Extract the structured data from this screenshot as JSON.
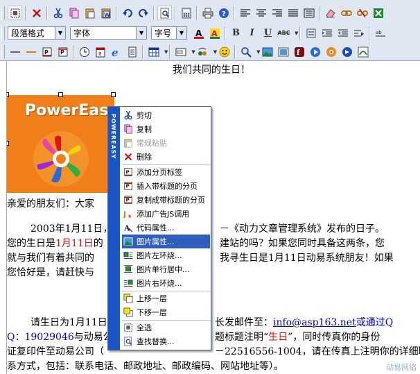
{
  "toolbar": {
    "row1": [
      "source-view-icon",
      "delete-icon",
      "cut-icon",
      "copy-icon",
      "paste-icon",
      "paste-word-icon",
      "undo-icon",
      "redo-icon",
      "preview-icon",
      "calculator-icon",
      "print-icon",
      "help-icon",
      "align-left-icon",
      "align-center-icon",
      "align-right-icon",
      "justify-icon",
      "full-width-icon",
      "eraser-icon",
      "link-icon",
      "unlink-icon",
      "excel-icon"
    ],
    "paragraph_format": "段落格式",
    "font_family": "字体",
    "font_size": "字号",
    "format_buttons": {
      "bold": "B",
      "italic": "I",
      "underline": "U",
      "abc": "ABC"
    },
    "accent_color": "#c00000"
  },
  "document": {
    "title": "我们共同的生日！",
    "greeting": "亲爱的朋友们：大家",
    "p1_line1_a": "2003年1月11日，",
    "p1_line1_b": "－《动力文章管理系统》发布的日子。",
    "p1_line2_a": "您的生日是",
    "p1_line2_red": "1月11日",
    "p1_line2_b": "的",
    "p1_line2_c": "建站的吗？如果您同时具备这两条，您",
    "p1_line3_a": "就与我们有着共同的",
    "p1_line3_b": "我寻生日是1月11日动易系统朋友！如果",
    "p1_line4_a": "您恰好是，请赶快与",
    "p2_line1_a": "请生日为1月11日",
    "p2_line1_b": "长发邮件至：",
    "p2_email": "info@asp163.net",
    "p2_line1_c": "或通过Q",
    "p2_line2_a": "Q：19029046",
    "p2_line2_b": "与动易公",
    "p2_line2_c": "题标题注明“",
    "p2_line2_red": "生日",
    "p2_line2_d": "”，同时传真你的身份",
    "p2_line3_a": "证复印件至动易公司（",
    "p2_line3_b": "－22516556-1004，请在传真上注明你的详细联",
    "p3_line": "系方式，包括：联系电话、邮政地址、邮政编码、网站地址等）。",
    "image_alt": "PowerEasy",
    "watermark": "动易网络"
  },
  "context_menu": {
    "brand": "POWEREASY",
    "items": [
      {
        "label": "剪切",
        "icon": "cut-icon",
        "enabled": true
      },
      {
        "label": "复制",
        "icon": "copy-icon",
        "enabled": true
      },
      {
        "label": "常规粘贴",
        "icon": "paste-icon",
        "enabled": false
      },
      {
        "label": "删除",
        "icon": "delete-icon",
        "enabled": true
      },
      {
        "label": "添加分页标签",
        "icon": "page-break-icon",
        "enabled": true
      },
      {
        "label": "插入带标题的分页",
        "icon": "titled-page-icon",
        "enabled": true
      },
      {
        "label": "复制成带标题的分页",
        "icon": "copy-titled-page-icon",
        "enabled": true
      },
      {
        "label": "添加广告JS调用",
        "icon": "js-icon",
        "enabled": true
      },
      {
        "label": "代码属性...",
        "icon": "code-properties-icon",
        "enabled": true
      },
      {
        "label": "图片属性...",
        "icon": "image-properties-icon",
        "enabled": true,
        "highlighted": true
      },
      {
        "label": "图片左环绕...",
        "icon": "wrap-left-icon",
        "enabled": true
      },
      {
        "label": "图片单行居中...",
        "icon": "center-line-icon",
        "enabled": true
      },
      {
        "label": "图片右环绕...",
        "icon": "wrap-right-icon",
        "enabled": true
      },
      {
        "label": "上移一层",
        "icon": "layer-up-icon",
        "enabled": true
      },
      {
        "label": "下移一层",
        "icon": "layer-down-icon",
        "enabled": true
      },
      {
        "label": "全选",
        "icon": "select-all-icon",
        "enabled": true
      },
      {
        "label": "查找替换...",
        "icon": "find-replace-icon",
        "enabled": true
      }
    ]
  }
}
